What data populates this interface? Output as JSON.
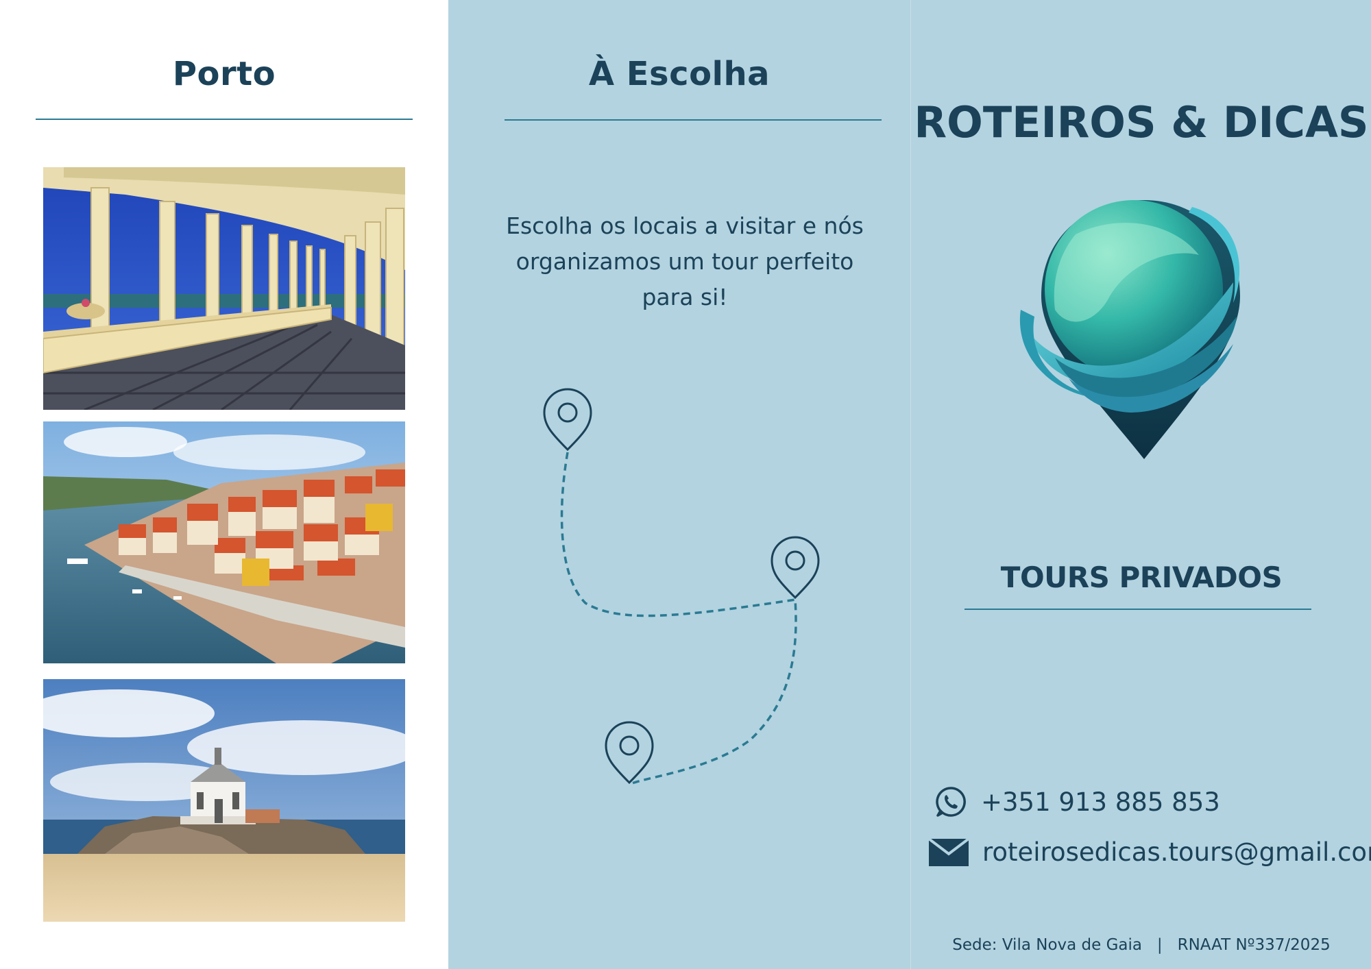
{
  "left_panel": {
    "title": "Porto",
    "photos": [
      "porto-colonnade-photo",
      "porto-ribeira-photo",
      "senhor-da-pedra-chapel-photo"
    ]
  },
  "middle_panel": {
    "title": "À Escolha",
    "text_lines": [
      "Escolha os locais a visitar e nós",
      "organizamos um tour perfeito",
      "para si!"
    ],
    "icons": [
      "map-pin-icon",
      "map-pin-icon",
      "map-pin-icon"
    ]
  },
  "right_panel": {
    "brand": "ROTEIROS & DICAS",
    "logo_icon": "globe-map-pin-logo",
    "subtitle": "TOURS PRIVADOS",
    "phone": "+351 913 885 853",
    "phone_icon": "whatsapp-icon",
    "email": "roteirosedicas.tours@gmail.com",
    "email_icon": "envelope-icon",
    "footer": "Sede: Vila Nova de Gaia   |   RNAAT Nº337/2025"
  },
  "colors": {
    "panel_background": "#b3d3e0",
    "heading": "#1b4258",
    "accent": "#2b7a92",
    "route": "#2b7a92"
  }
}
